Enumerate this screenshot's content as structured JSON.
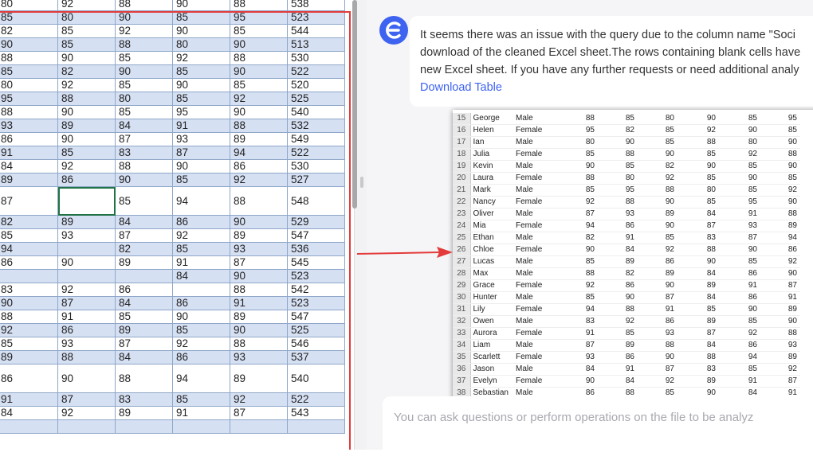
{
  "sheet": {
    "rows": [
      {
        "cells": [
          "80",
          "92",
          "88",
          "90",
          "88",
          "538"
        ],
        "tall": false
      },
      {
        "cells": [
          "85",
          "80",
          "90",
          "85",
          "95",
          "523"
        ],
        "tall": false
      },
      {
        "cells": [
          "82",
          "85",
          "92",
          "90",
          "85",
          "544"
        ],
        "tall": false
      },
      {
        "cells": [
          "90",
          "85",
          "88",
          "80",
          "90",
          "513"
        ],
        "tall": false
      },
      {
        "cells": [
          "88",
          "90",
          "85",
          "92",
          "88",
          "530"
        ],
        "tall": false
      },
      {
        "cells": [
          "85",
          "82",
          "90",
          "85",
          "90",
          "522"
        ],
        "tall": false
      },
      {
        "cells": [
          "80",
          "92",
          "85",
          "90",
          "85",
          "520"
        ],
        "tall": false
      },
      {
        "cells": [
          "95",
          "88",
          "80",
          "85",
          "92",
          "525"
        ],
        "tall": false
      },
      {
        "cells": [
          "88",
          "90",
          "85",
          "95",
          "90",
          "540"
        ],
        "tall": false
      },
      {
        "cells": [
          "93",
          "89",
          "84",
          "91",
          "88",
          "532"
        ],
        "tall": false
      },
      {
        "cells": [
          "86",
          "90",
          "87",
          "93",
          "89",
          "549"
        ],
        "tall": false
      },
      {
        "cells": [
          "91",
          "85",
          "83",
          "87",
          "94",
          "522"
        ],
        "tall": false
      },
      {
        "cells": [
          "84",
          "92",
          "88",
          "90",
          "86",
          "530"
        ],
        "tall": false
      },
      {
        "cells": [
          "89",
          "86",
          "90",
          "85",
          "92",
          "527"
        ],
        "tall": false
      },
      {
        "cells": [
          "87",
          "",
          "85",
          "94",
          "88",
          "548"
        ],
        "tall": true
      },
      {
        "cells": [
          "82",
          "89",
          "84",
          "86",
          "90",
          "529"
        ],
        "tall": false
      },
      {
        "cells": [
          "85",
          "93",
          "87",
          "92",
          "89",
          "547"
        ],
        "tall": false
      },
      {
        "cells": [
          "94",
          "",
          "82",
          "85",
          "93",
          "536"
        ],
        "tall": false
      },
      {
        "cells": [
          "86",
          "90",
          "89",
          "91",
          "87",
          "545"
        ],
        "tall": false
      },
      {
        "cells": [
          "",
          "",
          "",
          "84",
          "90",
          "523"
        ],
        "tall": false
      },
      {
        "cells": [
          "83",
          "92",
          "86",
          "",
          "88",
          "542"
        ],
        "tall": false
      },
      {
        "cells": [
          "90",
          "87",
          "84",
          "86",
          "91",
          "523"
        ],
        "tall": false
      },
      {
        "cells": [
          "88",
          "91",
          "85",
          "90",
          "89",
          "547"
        ],
        "tall": false
      },
      {
        "cells": [
          "92",
          "86",
          "89",
          "85",
          "90",
          "525"
        ],
        "tall": false
      },
      {
        "cells": [
          "85",
          "93",
          "87",
          "92",
          "88",
          "546"
        ],
        "tall": false
      },
      {
        "cells": [
          "89",
          "88",
          "84",
          "86",
          "93",
          "537"
        ],
        "tall": false
      },
      {
        "cells": [
          "86",
          "90",
          "88",
          "94",
          "89",
          "540"
        ],
        "tall": true
      },
      {
        "cells": [
          "91",
          "87",
          "83",
          "85",
          "92",
          "522"
        ],
        "tall": false
      },
      {
        "cells": [
          "84",
          "92",
          "89",
          "91",
          "87",
          "543"
        ],
        "tall": false
      },
      {
        "cells": [
          "",
          "",
          "",
          "",
          "",
          ""
        ],
        "tall": false
      }
    ]
  },
  "chat": {
    "message_lines": [
      "It seems there was an issue with the query due to the column name \"Soci",
      "download of the cleaned Excel sheet.The rows containing blank cells have",
      "new Excel sheet. If you have any further requests or need additional analy"
    ],
    "download_label": "Download Table",
    "input_placeholder": "You can ask questions or perform operations on the file to be analyz"
  },
  "preview": {
    "rows": [
      [
        "15",
        "George",
        "Male",
        "88",
        "85",
        "80",
        "90",
        "85",
        "95"
      ],
      [
        "16",
        "Helen",
        "Female",
        "95",
        "82",
        "85",
        "92",
        "90",
        "85"
      ],
      [
        "17",
        "Ian",
        "Male",
        "80",
        "90",
        "85",
        "88",
        "80",
        "90"
      ],
      [
        "18",
        "Julia",
        "Female",
        "85",
        "88",
        "90",
        "85",
        "92",
        "88"
      ],
      [
        "19",
        "Kevin",
        "Male",
        "90",
        "85",
        "82",
        "90",
        "85",
        "90"
      ],
      [
        "20",
        "Laura",
        "Female",
        "88",
        "80",
        "92",
        "85",
        "90",
        "85"
      ],
      [
        "21",
        "Mark",
        "Male",
        "85",
        "95",
        "88",
        "80",
        "85",
        "92"
      ],
      [
        "22",
        "Nancy",
        "Female",
        "92",
        "88",
        "90",
        "85",
        "95",
        "90"
      ],
      [
        "23",
        "Oliver",
        "Male",
        "87",
        "93",
        "89",
        "84",
        "91",
        "88"
      ],
      [
        "24",
        "Mia",
        "Female",
        "94",
        "86",
        "90",
        "87",
        "93",
        "89"
      ],
      [
        "25",
        "Ethan",
        "Male",
        "82",
        "91",
        "85",
        "83",
        "87",
        "94"
      ],
      [
        "26",
        "Chloe",
        "Female",
        "90",
        "84",
        "92",
        "88",
        "90",
        "86"
      ],
      [
        "27",
        "Lucas",
        "Male",
        "85",
        "89",
        "86",
        "90",
        "85",
        "92"
      ],
      [
        "28",
        "Max",
        "Male",
        "88",
        "82",
        "89",
        "84",
        "86",
        "90"
      ],
      [
        "29",
        "Grace",
        "Female",
        "92",
        "86",
        "90",
        "89",
        "91",
        "87"
      ],
      [
        "30",
        "Hunter",
        "Male",
        "85",
        "90",
        "87",
        "84",
        "86",
        "91"
      ],
      [
        "31",
        "Lily",
        "Female",
        "94",
        "88",
        "91",
        "85",
        "90",
        "89"
      ],
      [
        "32",
        "Owen",
        "Male",
        "83",
        "92",
        "86",
        "89",
        "85",
        "90"
      ],
      [
        "33",
        "Aurora",
        "Female",
        "91",
        "85",
        "93",
        "87",
        "92",
        "88"
      ],
      [
        "34",
        "Liam",
        "Male",
        "87",
        "89",
        "88",
        "84",
        "86",
        "93"
      ],
      [
        "35",
        "Scarlett",
        "Female",
        "93",
        "86",
        "90",
        "88",
        "94",
        "89"
      ],
      [
        "36",
        "Jason",
        "Male",
        "84",
        "91",
        "87",
        "83",
        "85",
        "92"
      ],
      [
        "37",
        "Evelyn",
        "Female",
        "90",
        "84",
        "92",
        "89",
        "91",
        "87"
      ],
      [
        "38",
        "Sebastian",
        "Male",
        "86",
        "88",
        "85",
        "90",
        "84",
        "91"
      ]
    ]
  },
  "colors": {
    "accent": "#3d63f0",
    "highlight_box": "#e33b3b",
    "row_band": "#d6e0f3",
    "active_cell": "#217346"
  },
  "icons": {
    "assistant_avatar": "assistant-logo-icon",
    "arrow": "red-arrow-icon"
  }
}
